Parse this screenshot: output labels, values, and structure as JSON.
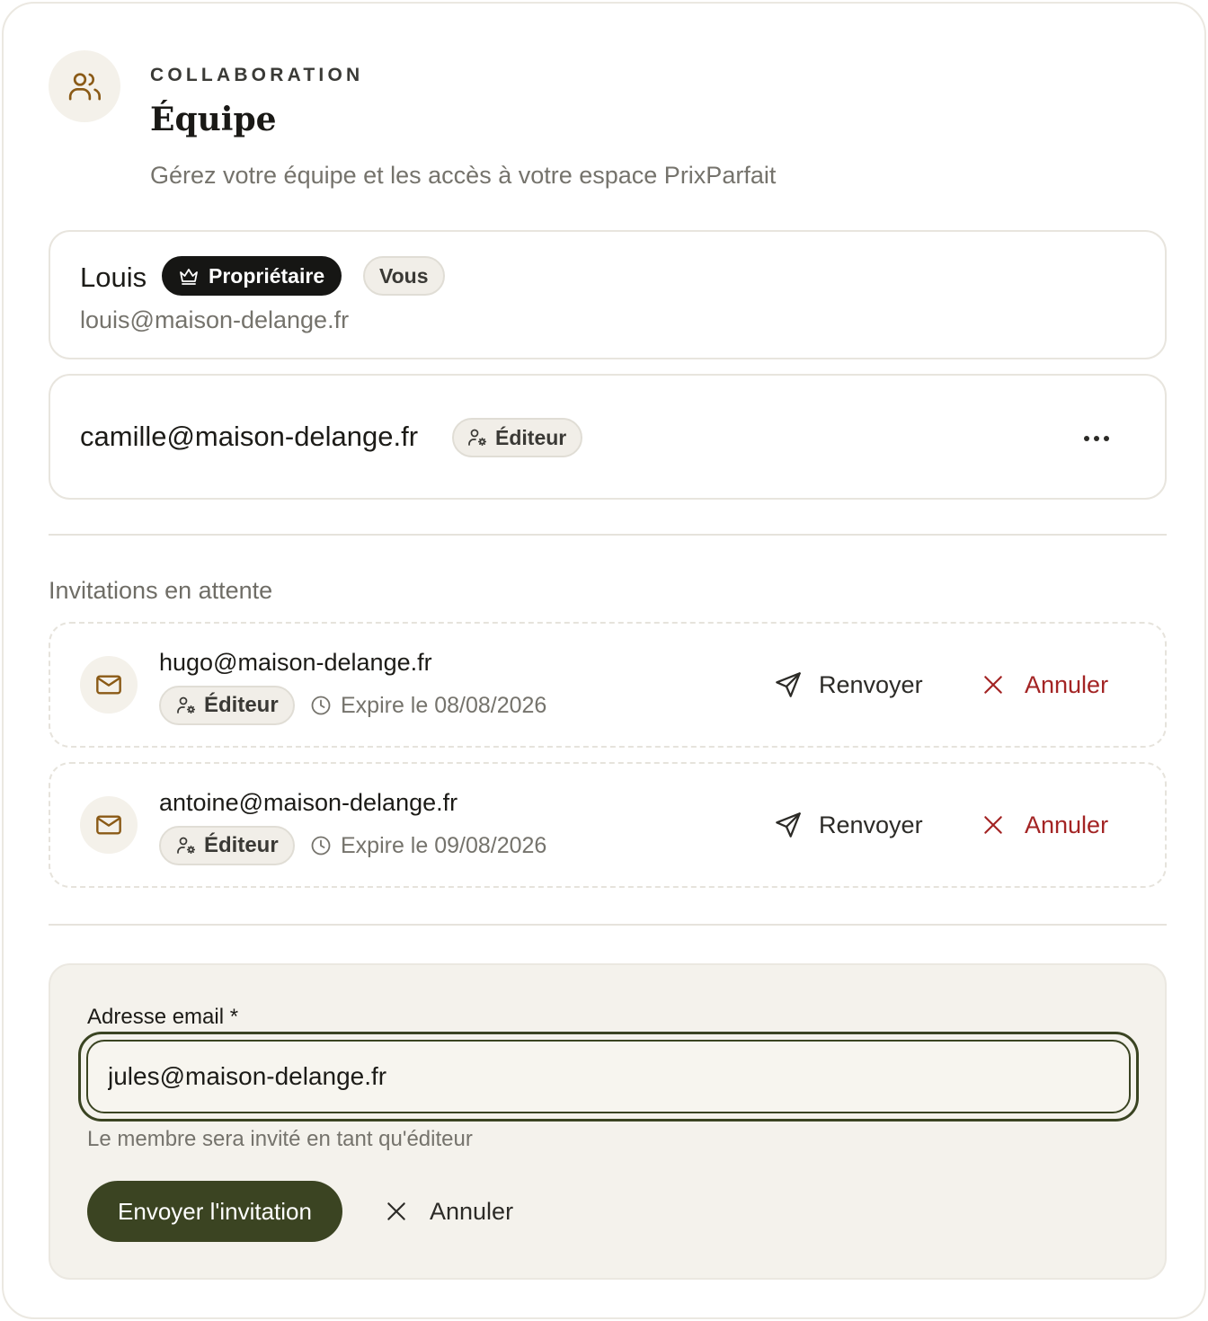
{
  "header": {
    "icon": "users-icon",
    "eyebrow": "COLLABORATION",
    "title": "Équipe",
    "subtitle": "Gérez votre équipe et les accès à votre espace PrixParfait"
  },
  "members": {
    "owner": {
      "name": "Louis",
      "role_label": "Propriétaire",
      "role_icon": "crown-icon",
      "you_label": "Vous",
      "email": "louis@maison-delange.fr"
    },
    "editor": {
      "email": "camille@maison-delange.fr",
      "role_label": "Éditeur",
      "role_icon": "user-cog-icon",
      "more_icon": "more-horizontal-icon"
    }
  },
  "invitations": {
    "title": "Invitations en attente",
    "items": [
      {
        "email": "hugo@maison-delange.fr",
        "role_label": "Éditeur",
        "expires": "Expire le 08/08/2026",
        "resend_label": "Renvoyer",
        "cancel_label": "Annuler"
      },
      {
        "email": "antoine@maison-delange.fr",
        "role_label": "Éditeur",
        "expires": "Expire le 09/08/2026",
        "resend_label": "Renvoyer",
        "cancel_label": "Annuler"
      }
    ]
  },
  "invite_form": {
    "label": "Adresse email *",
    "value": "jules@maison-delange.fr",
    "helper": "Le membre sera invité en tant qu'éditeur",
    "submit_label": "Envoyer l'invitation",
    "cancel_label": "Annuler"
  },
  "colors": {
    "accent": "#3b4422",
    "icon_brown": "#8a5a16",
    "danger": "#a32424",
    "owner_badge": "#161614"
  }
}
